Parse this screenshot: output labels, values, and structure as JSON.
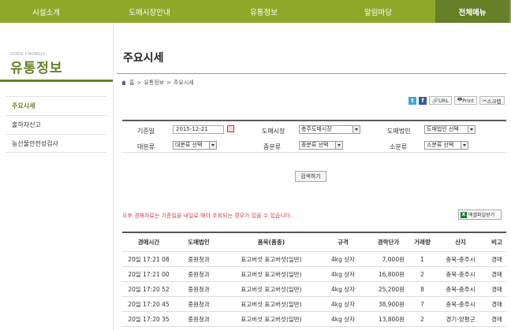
{
  "nav": {
    "items": [
      "시설소개",
      "도매시장안내",
      "유통정보",
      "알림마당",
      "전체메뉴"
    ]
  },
  "sidebar": {
    "brand_sub": "GOOD CHUNGJU",
    "brand_title": "유통정보",
    "items": [
      {
        "label": "주요시세",
        "active": true
      },
      {
        "label": "출하자신고",
        "active": false
      },
      {
        "label": "농산물안전성검사",
        "active": false
      }
    ]
  },
  "page": {
    "title": "주요시세",
    "breadcrumb": [
      "홈",
      ">",
      "유통정보",
      ">",
      "주요시세"
    ]
  },
  "share": {
    "twitter": "t",
    "facebook": "f",
    "url": "URL",
    "print": "Print",
    "scrap": "스크랩"
  },
  "search": {
    "date_label": "기준일",
    "date_value": "2015-12-21",
    "market_label": "도매시장",
    "market_value": "충주도매시장",
    "corp_label": "도매법인",
    "corp_value": "도매법인 선택",
    "large_label": "대분류",
    "large_value": "대분류 선택",
    "medium_label": "중분류",
    "medium_value": "중분류 선택",
    "small_label": "소분류",
    "small_value": "소분류 선택",
    "button": "검색하기"
  },
  "notice": "오후 경매자료는 기준일을 내일로 해야 조회되는 경우가 있을 수 있습니다.",
  "excel_button": "엑셀파일받기",
  "table": {
    "headers": [
      "경매시간",
      "도매법인",
      "품목(품종)",
      "규격",
      "경락단가",
      "거래량",
      "산지",
      "비고"
    ],
    "rows": [
      [
        "20일 17:21 08",
        "중원청과",
        "표고버섯 표고버섯(일반)",
        "4kg 상자",
        "7,000원",
        "1",
        "충북-충주시",
        "경매"
      ],
      [
        "20일 17:21 00",
        "중원청과",
        "표고버섯 표고버섯(일반)",
        "4kg 상자",
        "16,800원",
        "2",
        "충북-충주시",
        "경매"
      ],
      [
        "20일 17:20 52",
        "중원청과",
        "표고버섯 표고버섯(일반)",
        "4kg 상자",
        "25,200원",
        "8",
        "충북-충주시",
        "경매"
      ],
      [
        "20일 17:20 45",
        "중원청과",
        "표고버섯 표고버섯(일반)",
        "4kg 상자",
        "38,900원",
        "7",
        "충북-충주시",
        "경매"
      ],
      [
        "20일 17:20 35",
        "중원청과",
        "표고버섯 표고버섯(일반)",
        "4kg 상자",
        "13,800원",
        "2",
        "경기-양평군",
        "경매"
      ]
    ]
  },
  "colors": {
    "nav_bg": "#8fa82a",
    "nav_active": "#66802a",
    "brand": "#65822a",
    "notice": "#cc4444"
  }
}
